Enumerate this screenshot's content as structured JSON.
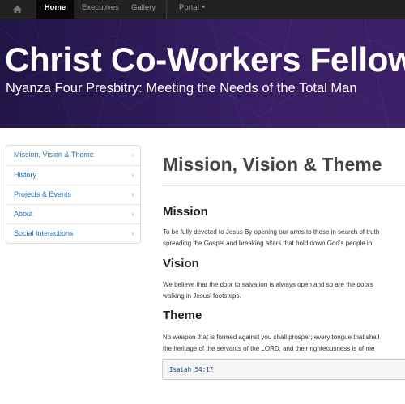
{
  "navbar": {
    "home_icon": "home-icon",
    "items": [
      {
        "label": "Home",
        "active": true
      },
      {
        "label": "Executives",
        "active": false
      },
      {
        "label": "Gallery",
        "active": false
      },
      {
        "label": "Portal",
        "active": false,
        "dropdown": true
      }
    ]
  },
  "hero": {
    "title": "Christ Co-Workers Fellowship",
    "subtitle": "Nyanza Four Presbitry: Meeting the Needs of the Total Man"
  },
  "sidebar": {
    "items": [
      {
        "label": "Mission, Vision & Theme"
      },
      {
        "label": "History"
      },
      {
        "label": "Projects & Events"
      },
      {
        "label": "About"
      },
      {
        "label": "Social Interactions"
      }
    ],
    "chevron": "›"
  },
  "main": {
    "title": "Mission, Vision & Theme",
    "mission": {
      "heading": "Mission",
      "lines": [
        "To be fully devoted to Jesus By opening our arms to those in search of truth",
        "spreading the Gospel and breaking altars that hold down God's people in"
      ]
    },
    "vision": {
      "heading": "Vision",
      "lines": [
        "We believe that the door to salvation is always open and so are the doors",
        "walking in Jesus' footsteps."
      ]
    },
    "theme": {
      "heading": "Theme",
      "lines": [
        "No weapon that is formed against you shall prosper; every tongue that shall",
        "the heritage of the servants of the LORD, and their righteousness is of me"
      ],
      "reference": "Isaiah 54:17"
    }
  },
  "colors": {
    "navbar_bg": "#222222",
    "hero_bg": "#2d1a58",
    "link": "#2a6ebb"
  }
}
